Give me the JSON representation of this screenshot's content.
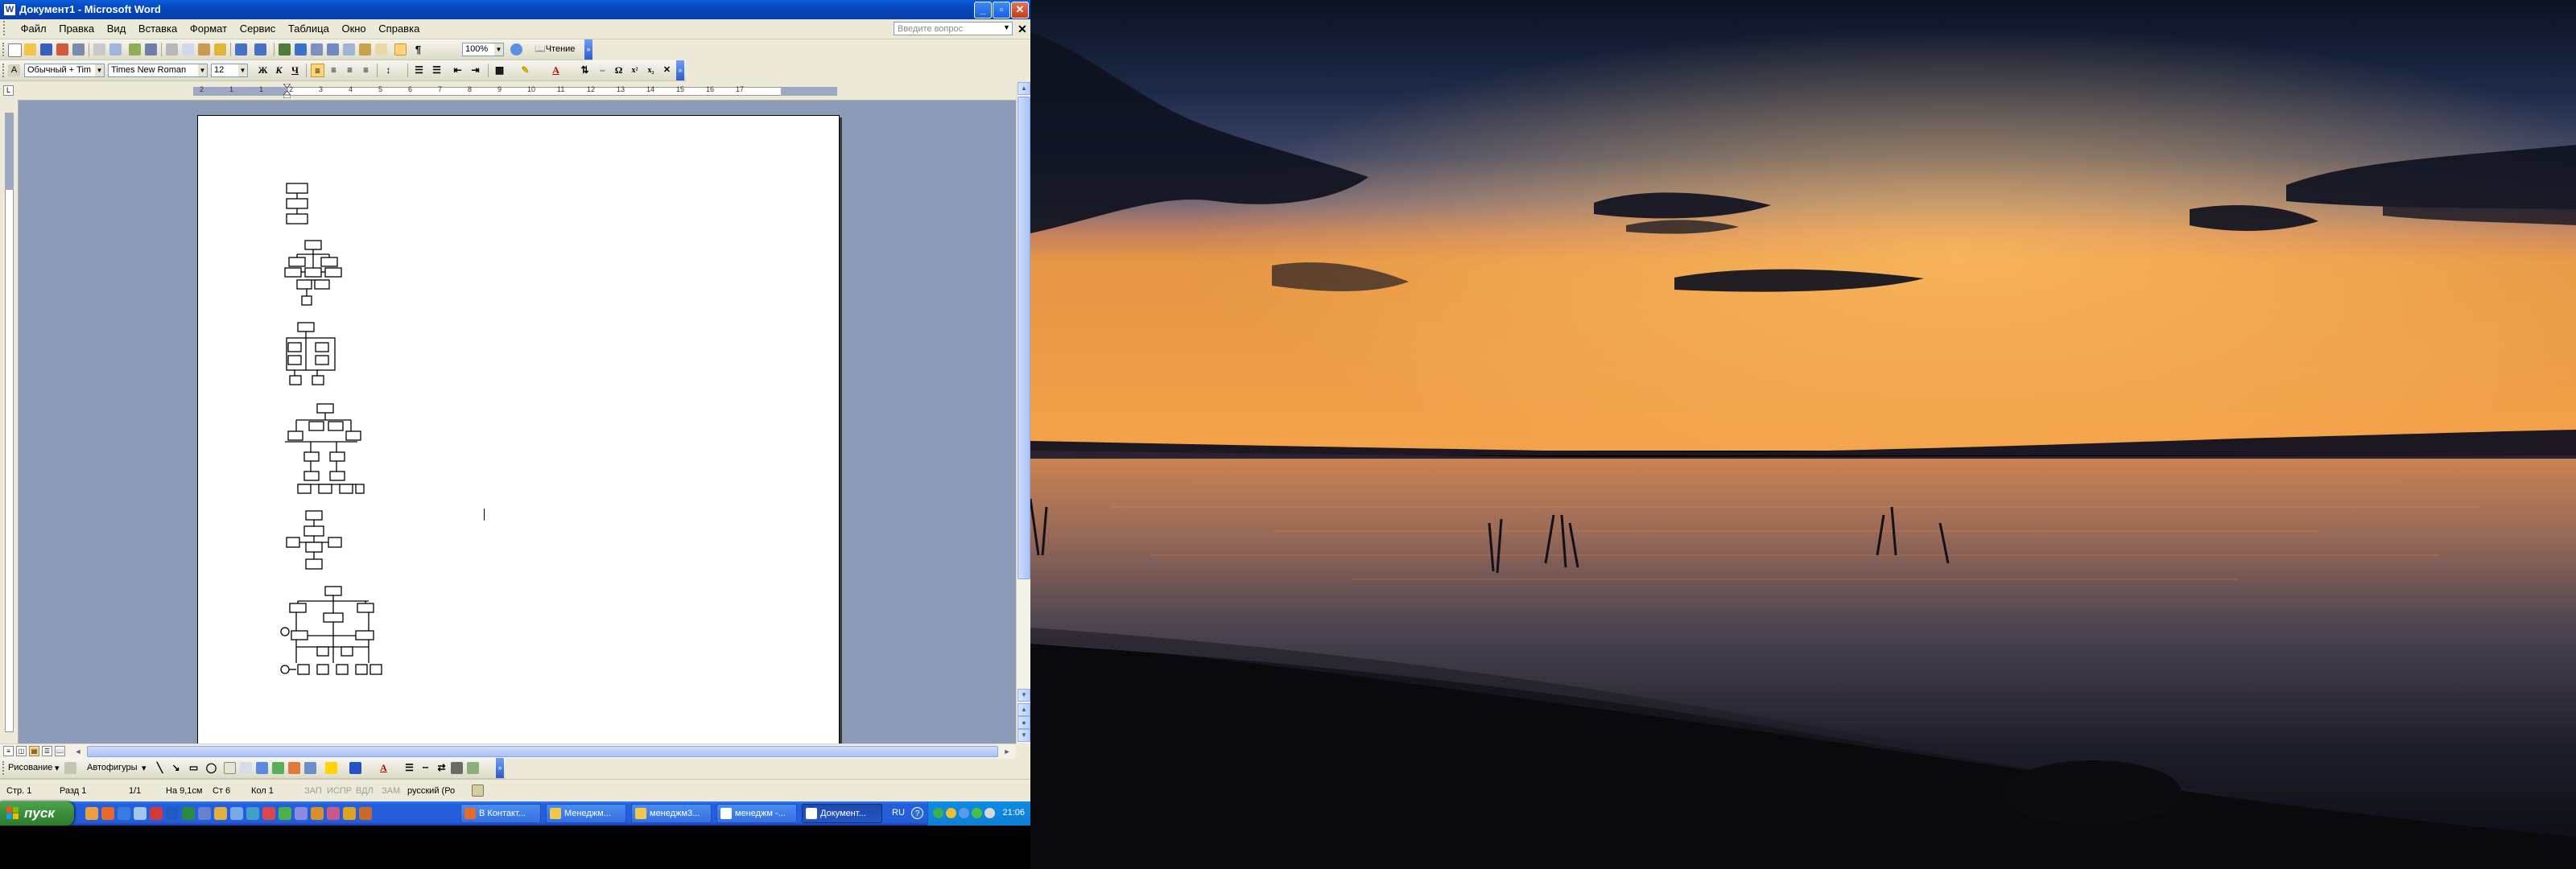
{
  "word": {
    "title": "Документ1 - Microsoft Word",
    "window_buttons": [
      "_",
      "▫",
      "✕"
    ],
    "menu": [
      "Файл",
      "Правка",
      "Вид",
      "Вставка",
      "Формат",
      "Сервис",
      "Таблица",
      "Окно",
      "Справка"
    ],
    "ask_placeholder": "Введите вопрос",
    "zoom": "100%",
    "read_label": "Чтение",
    "style_value": "Обычный + Tim",
    "font_value": "Times New Roman",
    "size_value": "12",
    "format_buttons": [
      "Ж",
      "К",
      "Ч"
    ],
    "ruler_labels": [
      "2",
      "1",
      "1",
      "2",
      "3",
      "4",
      "5",
      "6",
      "7",
      "8",
      "9",
      "10",
      "11",
      "12",
      "13",
      "14",
      "15",
      "16",
      "17"
    ],
    "icons": {
      "new": "new-doc-icon",
      "open": "open-icon",
      "save": "save-icon",
      "print": "print-icon",
      "undo": "undo-icon",
      "redo": "redo-icon",
      "help": "help-icon"
    }
  },
  "drawing": {
    "draw_label": "Рисование",
    "autoshapes_label": "Автофигуры"
  },
  "status": {
    "page": "Стр. 1",
    "section": "Разд 1",
    "pages": "1/1",
    "at": "На 9,1см",
    "line": "Ст 6",
    "col": "Кол 1",
    "rec": "ЗАП",
    "trk": "ИСПР",
    "ext": "ВДЛ",
    "ovr": "ЗАМ",
    "lang": "русский (Ро"
  },
  "taskbar": {
    "start_label": "пуск",
    "tasks": [
      "В Контакт...",
      "Менеджм...",
      "менеджм3...",
      "менеджм -...",
      "Документ..."
    ],
    "lang": "RU",
    "clock": "21:06"
  }
}
